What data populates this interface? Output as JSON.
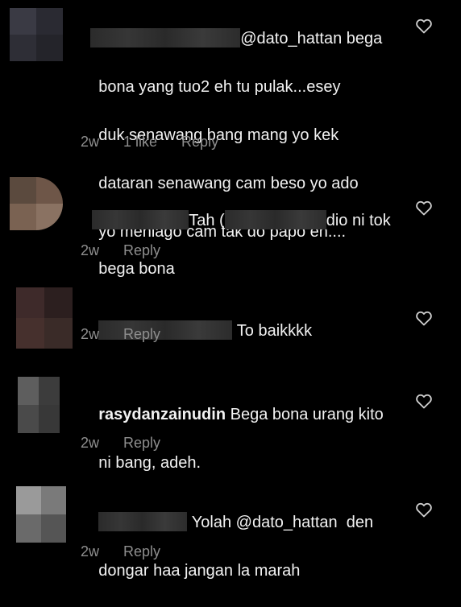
{
  "comments": [
    {
      "username": "",
      "mention": "@dato_hattan",
      "text_after_mention": " bega",
      "lines": [
        "bona yang tuo2 eh tu pulak...esey",
        "duk senawang bang mang yo kek",
        "dataran senawang cam beso yo ado",
        "yo meniago cam tak do papo eh...."
      ],
      "time": "2w",
      "likes": "1 like",
      "reply": "Reply",
      "avatar_colors": [
        "#3a3a44",
        "#2a2a32",
        "#2e2e36",
        "#24242a"
      ]
    },
    {
      "username": "",
      "text_part1": "Tah (",
      "text_part2": "dio ni tok",
      "lines": [
        "bega bona"
      ],
      "time": "2w",
      "reply": "Reply",
      "avatar_colors": [
        "#5b4a3e",
        "#6e5648",
        "#7a6252",
        "#8a7262"
      ]
    },
    {
      "username": "",
      "text": "To baikkkk",
      "time": "2w",
      "reply": "Reply",
      "avatar_colors": [
        "#3e2a2a",
        "#2c1f1f",
        "#46302d",
        "#3a2b28"
      ]
    },
    {
      "username": "rasydanzainudin",
      "text": "Bega bona urang kito",
      "lines": [
        "ni bang, adeh."
      ],
      "time": "2w",
      "reply": "Reply",
      "avatar_colors": [
        "#5e5e5e",
        "#3c3c3c",
        "#4a4a4a",
        "#383838"
      ]
    },
    {
      "username": "",
      "text": "Yolah @dato_hattan  den",
      "lines": [
        "dongar haa jangan la marah"
      ],
      "time": "2w",
      "reply": "Reply",
      "avatar_colors": [
        "#9a9a9a",
        "#7a7a7a",
        "#6a6a6a",
        "#555555"
      ]
    }
  ],
  "icons": {
    "like": "heart-outline-icon"
  },
  "colors": {
    "background": "#000000",
    "text": "#f2f2f2",
    "meta": "#8e8e8e"
  }
}
